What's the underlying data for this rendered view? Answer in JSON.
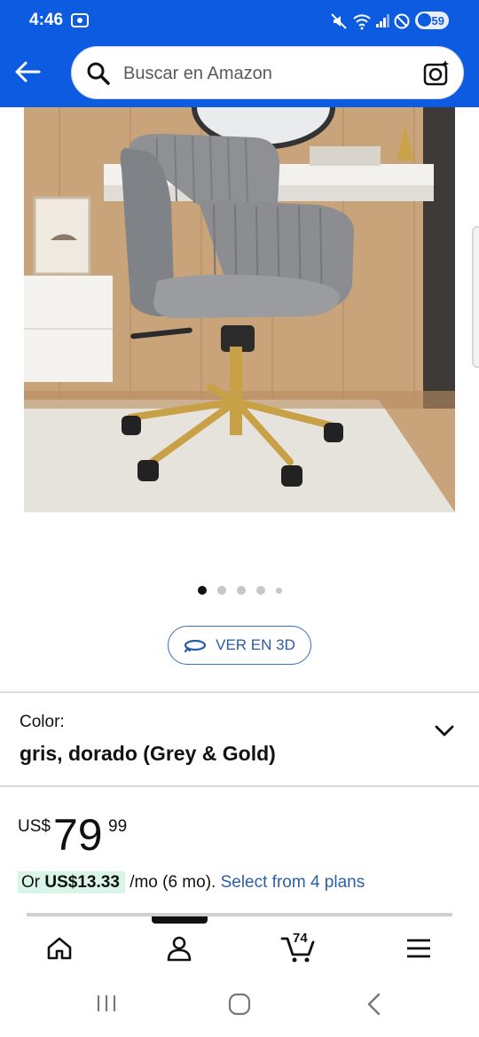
{
  "status_bar": {
    "time": "4:46",
    "battery": "59",
    "icons": [
      "screenshot-icon",
      "mute-icon",
      "wifi-icon",
      "signal-icon",
      "dnd-icon",
      "battery-icon"
    ]
  },
  "header": {
    "search_placeholder": "Buscar en Amazon",
    "icons": [
      "back-arrow-icon",
      "search-icon",
      "camera-search-icon"
    ]
  },
  "gallery": {
    "total_images": 5,
    "active_index": 0
  },
  "view_3d": {
    "label": "VER EN 3D"
  },
  "variation": {
    "label": "Color:",
    "value": "gris, dorado (Grey & Gold)"
  },
  "price": {
    "currency": "US$",
    "whole": "79",
    "fraction": "99"
  },
  "installment": {
    "prefix": "Or",
    "amount": "US$13.33",
    "terms": "/mo (6 mo).",
    "link": "Select from 4 plans"
  },
  "bottom_nav": {
    "items": [
      "home-icon",
      "account-icon",
      "cart-icon",
      "menu-icon"
    ],
    "cart_count": "74"
  },
  "colors": {
    "brand_blue": "#0d5be0",
    "link_blue": "#2a5fa8",
    "installment_highlight": "#d8f5e8"
  }
}
